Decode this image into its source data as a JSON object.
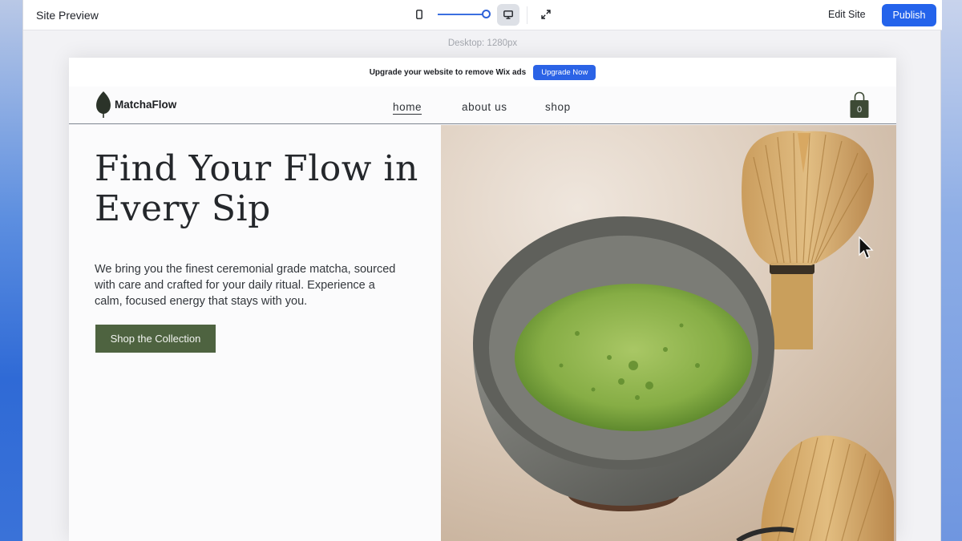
{
  "toolbar": {
    "title": "Site Preview",
    "viewport_label": "Desktop: 1280px",
    "edit_site_label": "Edit Site",
    "publish_label": "Publish",
    "mobile_icon": "mobile-device-icon",
    "desktop_icon": "desktop-monitor-icon",
    "expand_icon": "expand-arrows-icon",
    "accent_color": "#2463eb"
  },
  "ads_banner": {
    "text": "Upgrade your website to remove Wix ads",
    "button_label": "Upgrade Now"
  },
  "site": {
    "brand": "MatchaFlow",
    "logo_icon": "leaf-icon",
    "nav": {
      "home": "home",
      "about": "about us",
      "shop": "shop"
    },
    "cart_icon": "shopping-bag-icon",
    "cart_count": "0",
    "hero": {
      "headline": "Find Your Flow in Every Sip",
      "subcopy": "We bring you the finest ceremonial grade matcha, sourced with care and crafted for your daily ritual. Experience a calm, focused energy that stays with you.",
      "cta_label": "Shop the Collection",
      "cta_color": "#4e6340"
    }
  }
}
